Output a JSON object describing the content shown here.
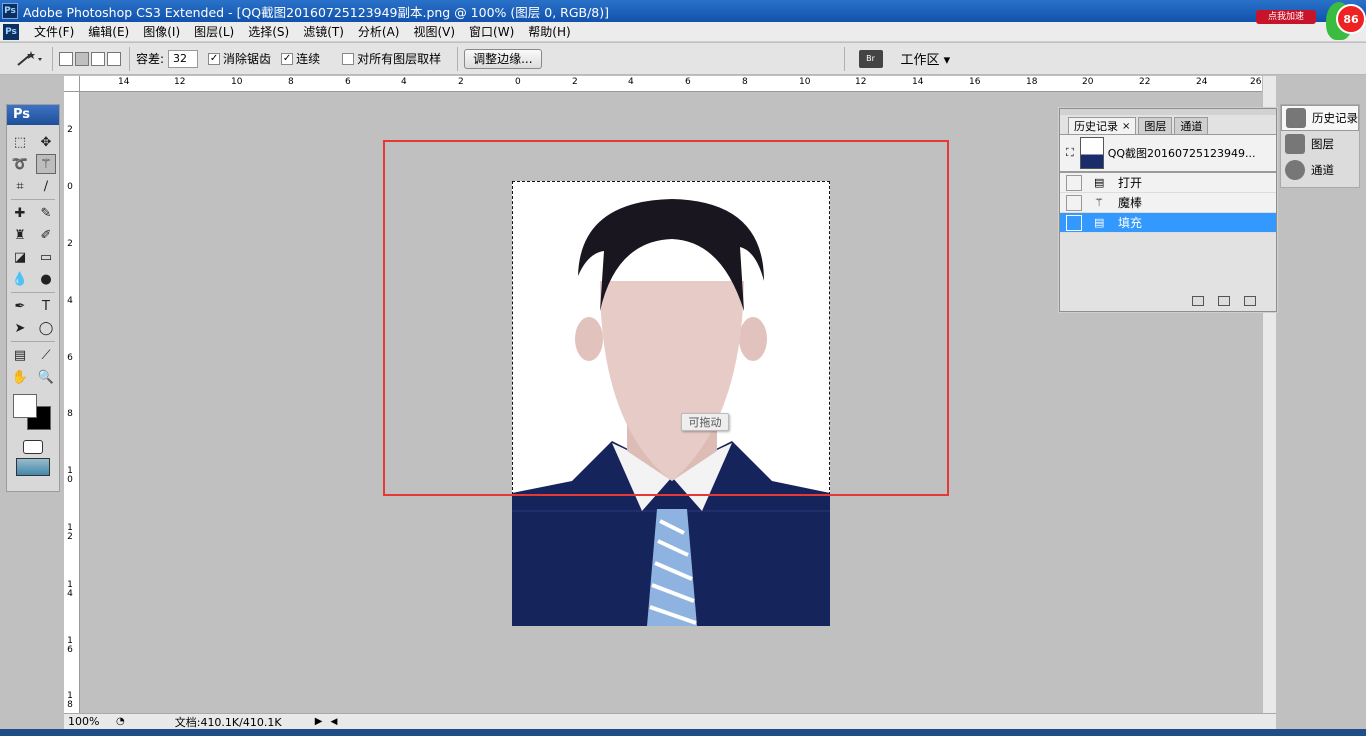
{
  "window": {
    "title": "Adobe Photoshop CS3 Extended - [QQ截图20160725123949副本.png @ 100% (图层 0, RGB/8)]",
    "app_logo": "Ps"
  },
  "menu": [
    "文件(F)",
    "编辑(E)",
    "图像(I)",
    "图层(L)",
    "选择(S)",
    "滤镜(T)",
    "分析(A)",
    "视图(V)",
    "窗口(W)",
    "帮助(H)"
  ],
  "badge": {
    "text": "点我加速",
    "number": "86"
  },
  "options": {
    "tolerance_label": "容差:",
    "tolerance_value": "32",
    "antialias_label": "消除锯齿",
    "antialias_checked": "✓",
    "contiguous_label": "连续",
    "contiguous_checked": "✓",
    "sample_all_label": "对所有图层取样",
    "refine_button": "调整边缘...",
    "bridge_label": "Br",
    "workspace_label": "工作区 ▾"
  },
  "toolbox": {
    "logo": "Ps"
  },
  "rulers": {
    "top": [
      "14",
      "12",
      "10",
      "8",
      "6",
      "4",
      "2",
      "0",
      "2",
      "4",
      "6",
      "8",
      "10",
      "12",
      "14",
      "16",
      "18",
      "20",
      "22",
      "24",
      "26"
    ],
    "left": [
      "2",
      "0",
      "2",
      "4",
      "6",
      "8",
      "10",
      "12",
      "14",
      "16",
      "18"
    ]
  },
  "canvas": {
    "drag_hint": "可拖动"
  },
  "status": {
    "zoom": "100%",
    "doc_info": "文档:410.1K/410.1K"
  },
  "history_panel": {
    "tabs": [
      "历史记录",
      "图层",
      "通道"
    ],
    "snapshot_label": "QQ截图20160725123949...",
    "entries": [
      {
        "icon": "open-doc-icon",
        "label": "打开"
      },
      {
        "icon": "magic-wand-icon",
        "label": "魔棒"
      },
      {
        "icon": "fill-icon",
        "label": "填充"
      }
    ]
  },
  "dock": {
    "items": [
      "历史记录",
      "图层",
      "通道"
    ]
  },
  "colors": {
    "title_bar": "#1a5cb8",
    "selection_red": "#e53935",
    "history_current": "#3399ff",
    "suit_navy": "#16245c"
  }
}
